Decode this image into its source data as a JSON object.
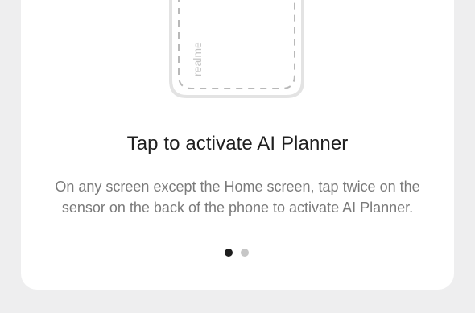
{
  "illustration": {
    "brand_text": "realme",
    "icon": "phone-back-icon"
  },
  "onboarding": {
    "title": "Tap to activate AI Planner",
    "description": "On any screen except the Home screen, tap twice on the sensor on the back of the phone to activate AI Planner."
  },
  "pager": {
    "total_pages": 2,
    "current_page": 1
  },
  "colors": {
    "background": "#eeeeef",
    "card": "#ffffff",
    "title": "#1f1f1f",
    "description": "#7a7a7a",
    "dot_active": "#1e1e1e",
    "dot_inactive": "#c6c6c6",
    "phone_outline": "#e3e3e3",
    "dash": "#b8b8b8"
  }
}
